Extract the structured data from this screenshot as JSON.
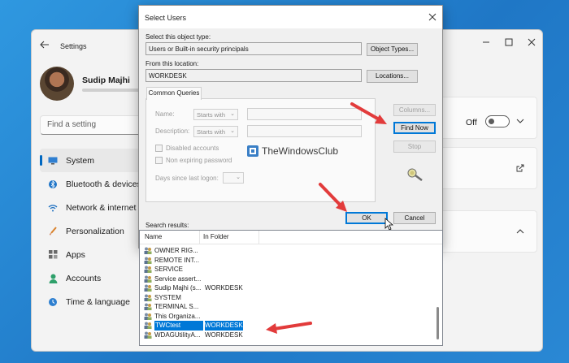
{
  "settings": {
    "title": "Settings",
    "profile_name": "Sudip Majhi",
    "search_placeholder": "Find a setting",
    "nav": [
      {
        "label": "System",
        "icon": "monitor-icon"
      },
      {
        "label": "Bluetooth & devices",
        "icon": "bluetooth-icon"
      },
      {
        "label": "Network & internet",
        "icon": "wifi-icon"
      },
      {
        "label": "Personalization",
        "icon": "brush-icon"
      },
      {
        "label": "Apps",
        "icon": "apps-icon"
      },
      {
        "label": "Accounts",
        "icon": "person-icon"
      },
      {
        "label": "Time & language",
        "icon": "globe-clock-icon"
      }
    ],
    "toggle_label": "Off",
    "toggle_on": false
  },
  "dialog": {
    "title": "Select Users",
    "object_type_label": "Select this object type:",
    "object_type_value": "Users or Built-in security principals",
    "object_types_button": "Object Types...",
    "location_label": "From this location:",
    "location_value": "WORKDESK",
    "locations_button": "Locations...",
    "tab_label": "Common Queries",
    "name_label": "Name:",
    "name_mode": "Starts with",
    "description_label": "Description:",
    "description_mode": "Starts with",
    "disabled_accounts": "Disabled accounts",
    "non_expiring": "Non expiring password",
    "days_label": "Days since last logon:",
    "columns_button": "Columns...",
    "find_now_button": "Find Now",
    "stop_button": "Stop",
    "ok_button": "OK",
    "cancel_button": "Cancel",
    "search_results_label": "Search results:",
    "columns": [
      "Name",
      "In Folder"
    ],
    "rows": [
      {
        "name": "OWNER RIG...",
        "folder": "",
        "selected": false
      },
      {
        "name": "REMOTE INT...",
        "folder": "",
        "selected": false
      },
      {
        "name": "SERVICE",
        "folder": "",
        "selected": false
      },
      {
        "name": "Service assert...",
        "folder": "",
        "selected": false
      },
      {
        "name": "Sudip Majhi (s...",
        "folder": "WORKDESK",
        "selected": false
      },
      {
        "name": "SYSTEM",
        "folder": "",
        "selected": false
      },
      {
        "name": "TERMINAL S...",
        "folder": "",
        "selected": false
      },
      {
        "name": "This Organiza...",
        "folder": "",
        "selected": false
      },
      {
        "name": "TWCtest",
        "folder": "WORKDESK",
        "selected": true
      },
      {
        "name": "WDAGUtilityA...",
        "folder": "WORKDESK",
        "selected": false
      }
    ]
  },
  "watermark": "TheWindowsClub",
  "colors": {
    "accent": "#0078d7",
    "arrow": "#e23b3b",
    "desktop": "#2d8fd6"
  }
}
